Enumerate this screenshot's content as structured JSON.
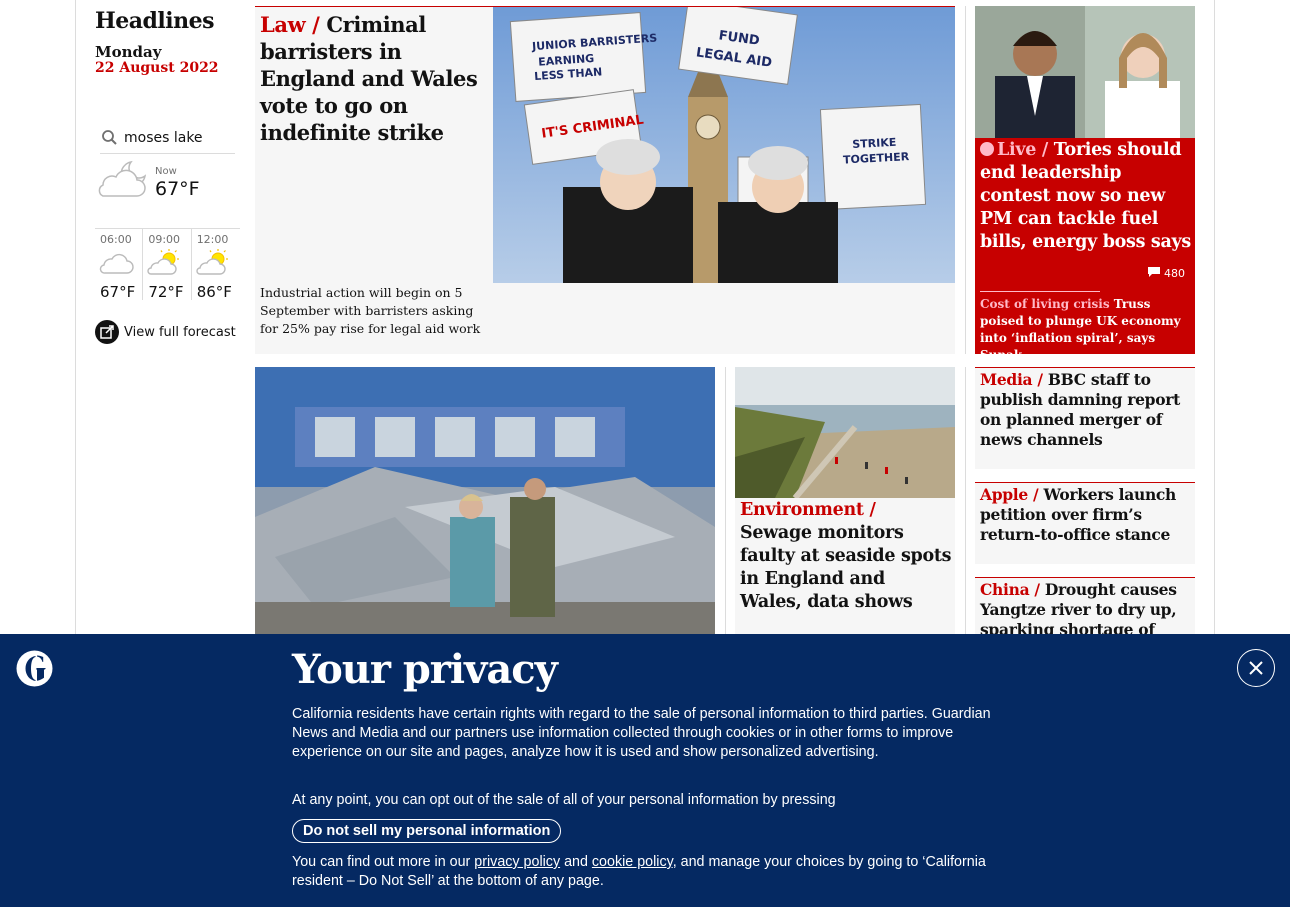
{
  "left_column": {
    "title": "Headlines",
    "day": "Monday",
    "date": "22 August 2022"
  },
  "weather": {
    "location": "moses lake",
    "now_label": "Now",
    "now_temp": "67°F",
    "now_icon": "partly-cloudy-night-icon",
    "hours": [
      {
        "time": "06:00",
        "temp": "67°F",
        "icon": "cloud-icon"
      },
      {
        "time": "09:00",
        "temp": "72°F",
        "icon": "sun-cloud-icon"
      },
      {
        "time": "12:00",
        "temp": "86°F",
        "icon": "sun-cloud-icon"
      }
    ],
    "forecast_link": "View full forecast"
  },
  "lead_story": {
    "kicker": "Law / ",
    "headline": "Criminal barristers in England and Wales vote to go on indefinite strike",
    "standfirst": "Industrial action will begin on 5 September with barristers asking for 25% pay rise for legal aid work"
  },
  "live_story": {
    "kicker": "Live / ",
    "headline": "Tories should end leadership contest now so new PM can tackle fuel bills, energy boss says",
    "comments": "480",
    "sub_kicker": "Cost of living crisis ",
    "sub_headline": "Truss poised to plunge UK economy into ‘inflation spiral’, says Sunak"
  },
  "env_story": {
    "kicker": "Environment /",
    "headline": "Sewage monitors faulty at seaside spots in England and Wales, data shows"
  },
  "small_stories": [
    {
      "kicker": "Media / ",
      "headline": "BBC staff to publish damning report on planned merger of news channels"
    },
    {
      "kicker": "Apple / ",
      "headline": "Workers launch petition over firm’s return-to-office stance"
    },
    {
      "kicker": "China / ",
      "headline": "Drought causes Yangtze river to dry up, sparking shortage of"
    }
  ],
  "privacy": {
    "title": "Your privacy",
    "para1": "California residents have certain rights with regard to the sale of personal information to third parties. Guardian News and Media and our partners use information collected through cookies or in other forms to improve experience on our site and pages, analyze how it is used and show personalized advertising.",
    "para2": "At any point, you can opt out of the sale of all of your personal information by pressing",
    "button": "Do not sell my personal information",
    "para3_start": "You can find out more in our ",
    "privacy_link": "privacy policy",
    "and": " and ",
    "cookie_link": "cookie policy",
    "para3_end": ", and manage your choices by going to ‘California resident – Do Not Sell’ at the bottom of any page."
  },
  "colors": {
    "news_red": "#c70000",
    "banner_blue": "#052962",
    "card_grey": "#f6f6f6"
  }
}
